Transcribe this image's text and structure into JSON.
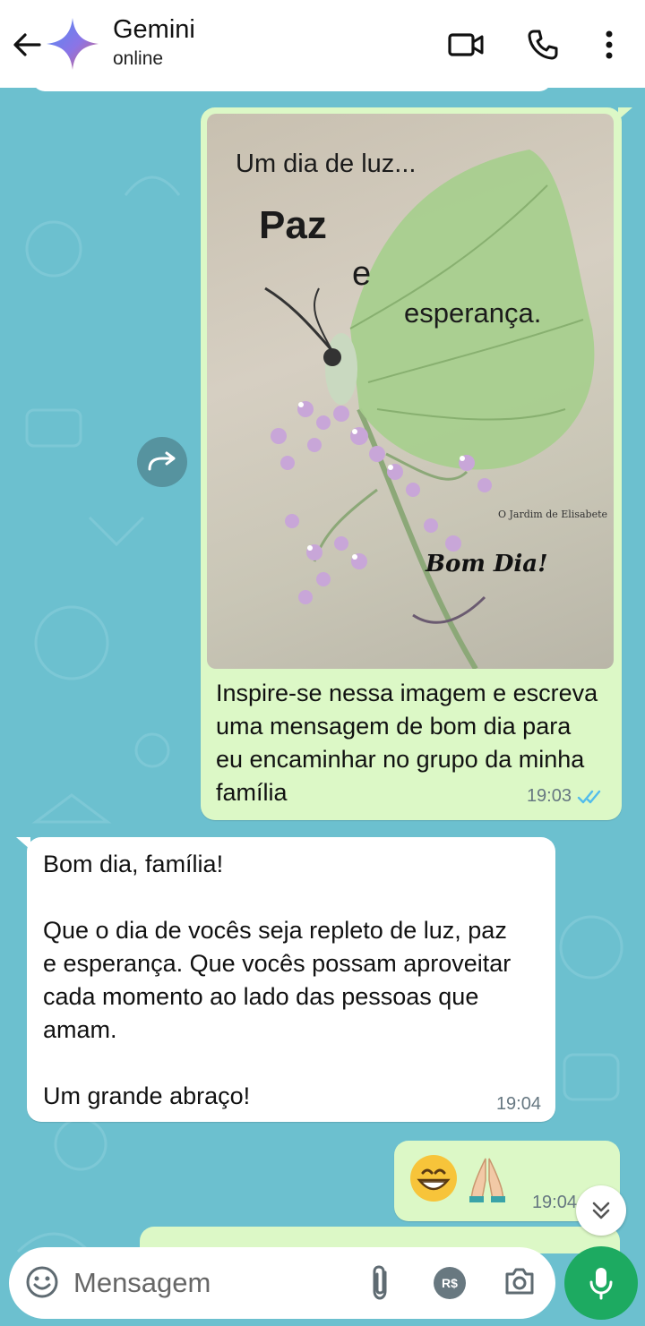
{
  "header": {
    "title": "Gemini",
    "status": "online",
    "icons": [
      "arrow-left-icon",
      "gemini-sparkle-icon",
      "video-call-icon",
      "phone-icon",
      "more-vert-icon"
    ]
  },
  "messages": [
    {
      "direction": "outgoing",
      "type": "image",
      "image_text": {
        "line1": "Um dia de luz...",
        "line2": "Paz",
        "line3": "e",
        "line4": "esperança.",
        "watermark": "O Jardim de Elisabete",
        "greeting": "Bom Dia!"
      },
      "caption": "Inspire-se nessa imagem e escreva uma mensagem de bom dia para eu encaminhar no grupo da minha família",
      "time": "19:03",
      "status": "read"
    },
    {
      "direction": "incoming",
      "type": "text",
      "text": "Bom dia, família!\n\nQue o dia de vocês seja repleto de luz, paz e esperança. Que vocês possam aproveitar cada momento ao lado das pessoas que amam.\n\nUm grande abraço!",
      "time": "19:04"
    },
    {
      "direction": "outgoing",
      "type": "emoji",
      "text": "😁🙏",
      "time": "19:04"
    }
  ],
  "composer": {
    "placeholder": "Mensagem",
    "payment_label": "R$"
  },
  "colors": {
    "chat_background": "#6cc0cf",
    "outgoing_bubble": "#dcf8c6",
    "incoming_bubble": "#ffffff",
    "read_ticks": "#53bdeb",
    "mic_button": "#1daa61"
  }
}
